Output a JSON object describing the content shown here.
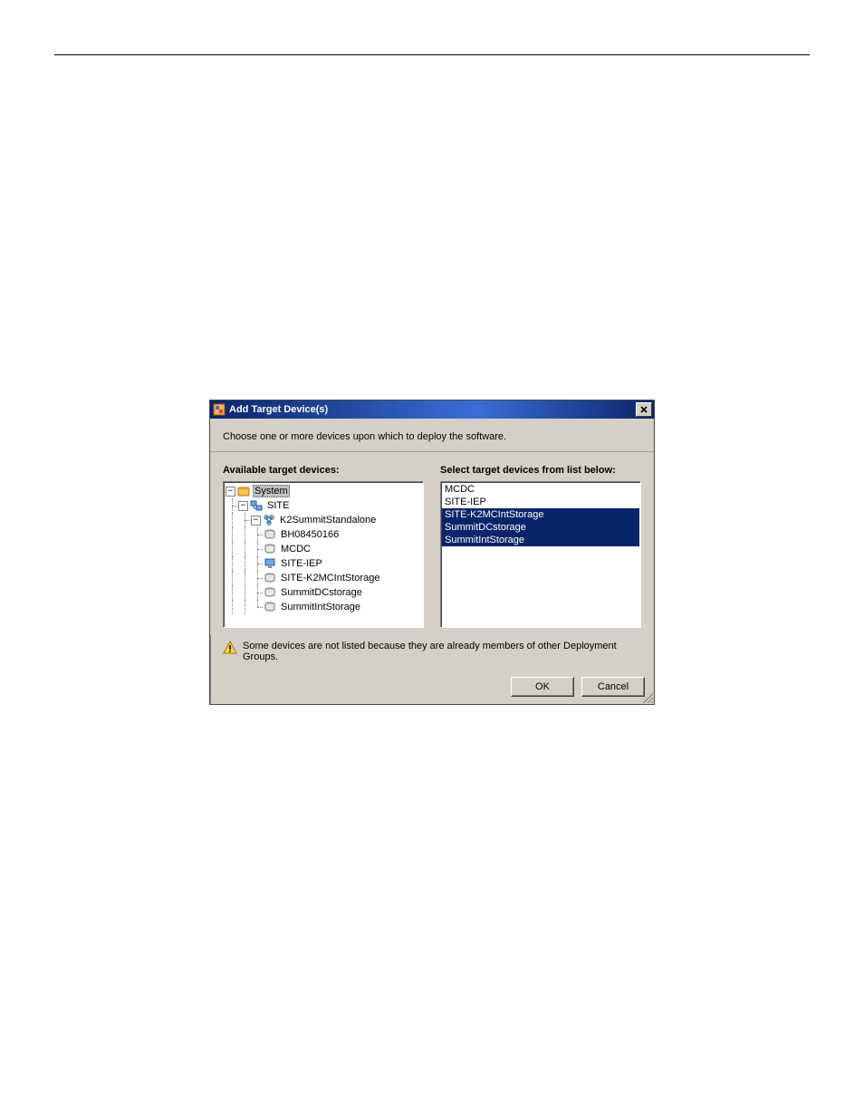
{
  "dialog": {
    "title": "Add Target Device(s)",
    "instruction": "Choose one or more devices upon which to deploy the software.",
    "left_label": "Available target devices:",
    "right_label": "Select target devices from list below:",
    "warning_text": "Some devices are not listed because they are already members of other Deployment Groups.",
    "ok_label": "OK",
    "cancel_label": "Cancel"
  },
  "tree": {
    "root": {
      "label": "System",
      "selected": true
    },
    "site": {
      "label": "SITE"
    },
    "group": {
      "label": "K2SummitStandalone"
    },
    "leaves": [
      {
        "label": "BH08450166",
        "icon": "drive"
      },
      {
        "label": "MCDC",
        "icon": "drive"
      },
      {
        "label": "SITE-IEP",
        "icon": "monitor"
      },
      {
        "label": "SITE-K2MCIntStorage",
        "icon": "drive"
      },
      {
        "label": "SummitDCstorage",
        "icon": "drive"
      },
      {
        "label": "SummitIntStorage",
        "icon": "drive"
      }
    ]
  },
  "list": {
    "items": [
      {
        "label": "MCDC",
        "selected": false
      },
      {
        "label": "SITE-IEP",
        "selected": false
      },
      {
        "label": "SITE-K2MCIntStorage",
        "selected": true
      },
      {
        "label": "SummitDCstorage",
        "selected": true
      },
      {
        "label": "SummitIntStorage",
        "selected": true
      }
    ]
  }
}
